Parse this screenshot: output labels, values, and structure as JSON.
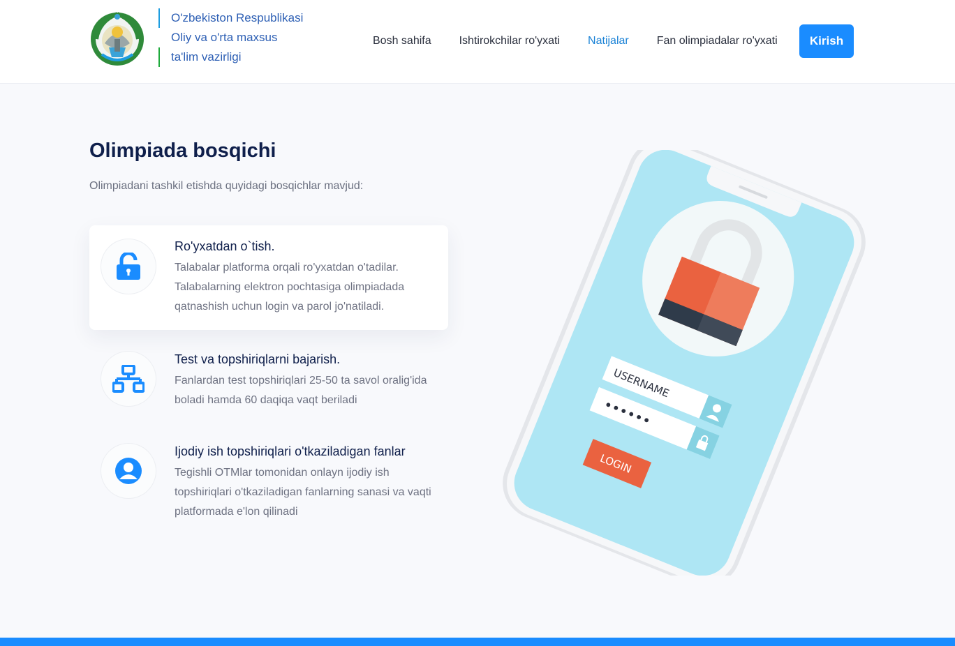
{
  "header": {
    "brand_lines": [
      "O'zbekiston Respublikasi",
      "Oliy va o'rta maxsus",
      "ta'lim vazirligi"
    ],
    "nav": [
      "Bosh sahifa",
      "Ishtirokchilar ro'yxati",
      "Natijalar",
      "Fan olimpiadalar ro'yxati"
    ],
    "active_nav": "Natijalar",
    "login_label": "Kirish"
  },
  "main": {
    "title": "Olimpiada bosqichi",
    "subtitle": "Olimpiadani tashkil etishda quyidagi bosqichlar mavjud:",
    "steps": [
      {
        "icon": "unlock-icon",
        "title": "Ro'yxatdan o`tish.",
        "desc": "Talabalar platforma orqali ro'yxatdan o'tadilar. Talabalarning elektron pochtasiga olimpiadada qatnashish uchun login va parol jo'natiladi."
      },
      {
        "icon": "network-icon",
        "title": "Test va topshiriqlarni bajarish.",
        "desc": "Fanlardan test topshiriqlari 25-50 ta savol oralig'ida boladi hamda 60 daqiqa vaqt beriladi"
      },
      {
        "icon": "user-icon",
        "title": "Ijodiy ish topshiriqlari o'tkaziladigan fanlar",
        "desc": "Tegishli OTMlar tomonidan onlayn ijodiy ish topshiriqlari o'tkaziladigan fanlarning sanasi va vaqti platformada e'lon qilinadi"
      }
    ]
  },
  "illustration": {
    "username_label": "USERNAME",
    "password_mask": "••••••",
    "login_label": "LOGIN"
  },
  "colors": {
    "accent": "#1a8cff",
    "title": "#0f1f4b",
    "phone_screen": "#aee6f4",
    "lock_body": "#ea6240"
  }
}
